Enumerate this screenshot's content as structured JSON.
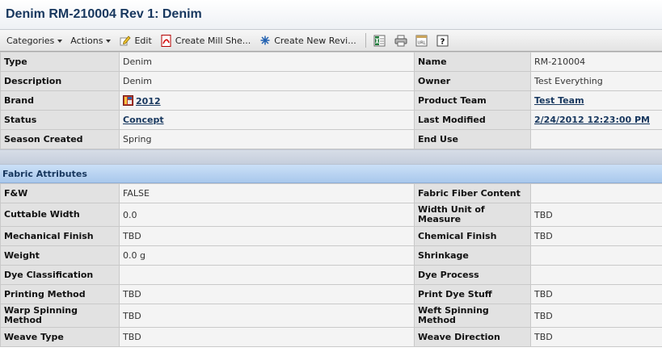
{
  "page": {
    "title": "Denim RM-210004 Rev 1: Denim"
  },
  "toolbar": {
    "categories": "Categories",
    "actions": "Actions",
    "edit": "Edit",
    "create_mill_sheet": "Create Mill She...",
    "create_new_revision": "Create New Revi..."
  },
  "details": {
    "type_label": "Type",
    "type_value": "Denim",
    "name_label": "Name",
    "name_value": "RM-210004",
    "description_label": "Description",
    "description_value": "Denim",
    "owner_label": "Owner",
    "owner_value": "Test Everything",
    "brand_label": "Brand",
    "brand_value": "2012",
    "product_team_label": "Product Team",
    "product_team_value": "Test Team",
    "status_label": "Status",
    "status_value": "Concept",
    "last_modified_label": "Last Modified",
    "last_modified_value": "2/24/2012 12:23:00 PM",
    "season_created_label": "Season Created",
    "season_created_value": "Spring",
    "end_use_label": "End Use",
    "end_use_value": ""
  },
  "fabric": {
    "section_title": "Fabric Attributes",
    "rows": [
      {
        "l1": "F&W",
        "v1": "FALSE",
        "l2": "Fabric Fiber Content",
        "v2": ""
      },
      {
        "l1": "Cuttable Width",
        "v1": "0.0",
        "l2": "Width Unit of Measure",
        "v2": "TBD"
      },
      {
        "l1": "Mechanical Finish",
        "v1": "TBD",
        "l2": "Chemical Finish",
        "v2": "TBD"
      },
      {
        "l1": "Weight",
        "v1": "0.0 g",
        "l2": "Shrinkage",
        "v2": ""
      },
      {
        "l1": "Dye Classification",
        "v1": "",
        "l2": "Dye Process",
        "v2": ""
      },
      {
        "l1": "Printing Method",
        "v1": "TBD",
        "l2": "Print Dye Stuff",
        "v2": "TBD"
      },
      {
        "l1": "Warp Spinning Method",
        "v1": "TBD",
        "l2": "Weft Spinning Method",
        "v2": "TBD"
      },
      {
        "l1": "Weave Type",
        "v1": "TBD",
        "l2": "Weave Direction",
        "v2": "TBD"
      }
    ]
  },
  "icons": {
    "edit": "pencil-icon",
    "pdf": "pdf-icon",
    "revision": "snowflake-icon",
    "excel": "excel-icon",
    "print": "printer-icon",
    "url": "url-icon",
    "help": "help-icon",
    "brand": "brand-icon"
  },
  "colors": {
    "title": "#17375e",
    "section_bg": "#b9d3f1",
    "label_bg": "#e2e2e2",
    "value_bg": "#f4f4f4"
  }
}
